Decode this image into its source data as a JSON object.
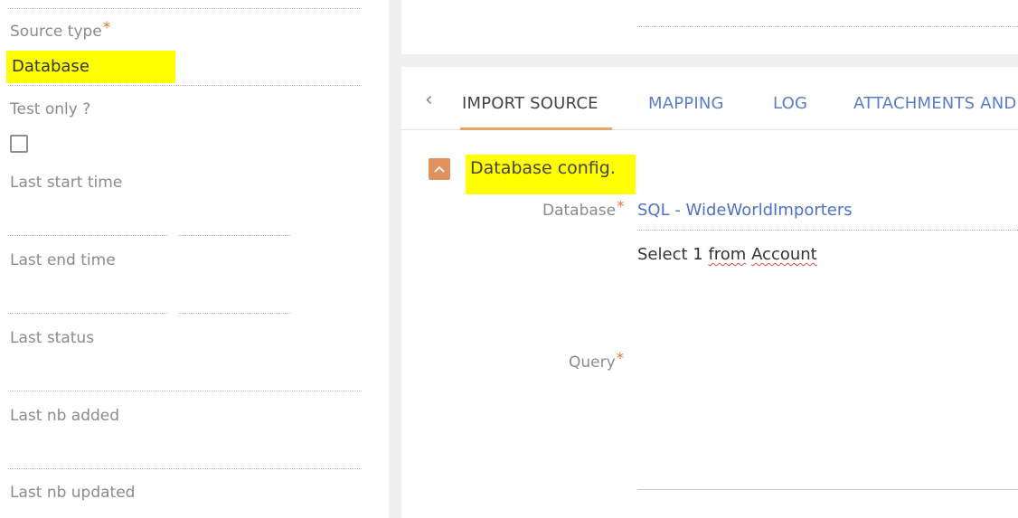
{
  "left_panel": {
    "source_type": {
      "label": "Source type",
      "required_mark": "*",
      "value": "Database"
    },
    "test_only": {
      "label": "Test only ?",
      "checked": false
    },
    "last_start_time": {
      "label": "Last start time"
    },
    "last_end_time": {
      "label": "Last end time"
    },
    "last_status": {
      "label": "Last status"
    },
    "last_nb_added": {
      "label": "Last nb added"
    },
    "last_nb_updated": {
      "label": "Last nb updated"
    }
  },
  "tabs": {
    "back_glyph": "‹",
    "items": [
      {
        "label": "IMPORT SOURCE",
        "active": true
      },
      {
        "label": "MAPPING",
        "active": false
      },
      {
        "label": "LOG",
        "active": false
      },
      {
        "label": "ATTACHMENTS AND",
        "active": false
      }
    ]
  },
  "section": {
    "title": "Database config.",
    "database": {
      "label": "Database",
      "required_mark": "*",
      "value": "SQL - WideWorldImporters"
    },
    "query": {
      "label": "Query",
      "required_mark": "*",
      "value_parts": [
        "Select 1 ",
        "from",
        " ",
        "Account"
      ]
    }
  },
  "colors": {
    "highlight": "#ffff00",
    "accent_orange": "#e0925e",
    "link_blue": "#4f73c3",
    "required_star": "#e8743b"
  }
}
